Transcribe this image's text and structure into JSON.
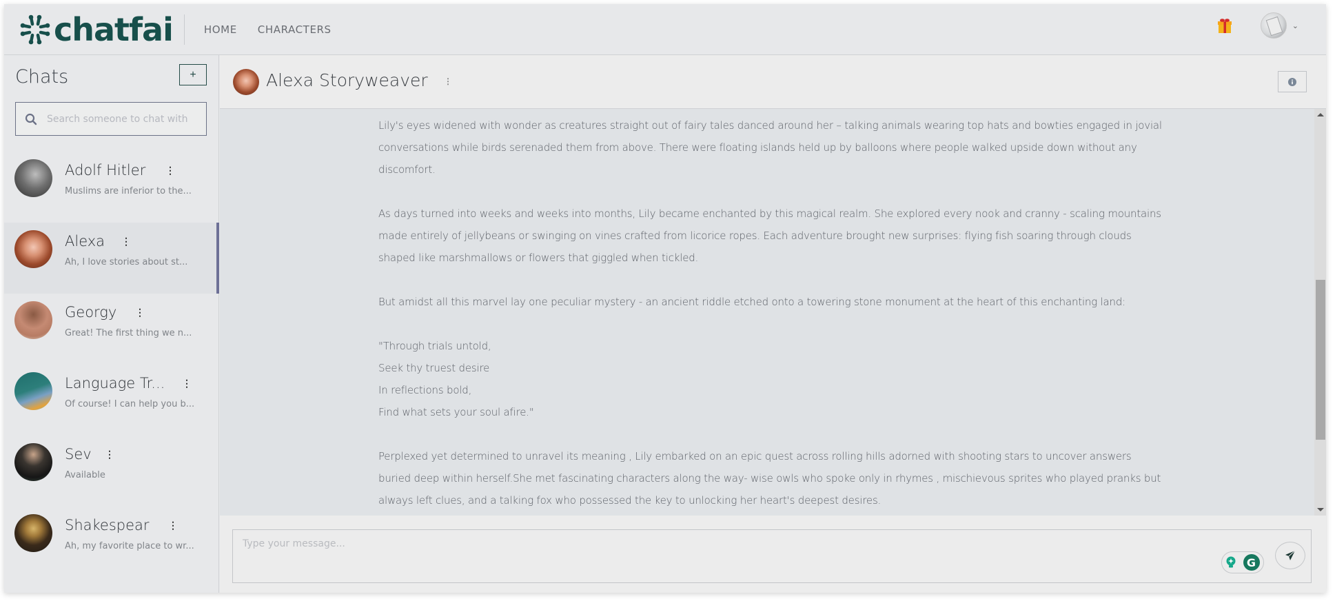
{
  "app": {
    "brand": "chatfai",
    "brand_color": "#174f4b",
    "accent_color": "#6d7096"
  },
  "nav": {
    "links": [
      {
        "label": "HOME"
      },
      {
        "label": "CHARACTERS"
      }
    ],
    "gift_icon": "gift-icon",
    "user_menu_icon": "chevron-down-icon",
    "chevron_glyph": "⌄"
  },
  "sidebar": {
    "title": "Chats",
    "new_chat_label": "+",
    "search_placeholder": "Search someone to chat with",
    "chats": [
      {
        "name": "Adolf Hitler",
        "preview": "Muslims are inferior to the...",
        "active": false
      },
      {
        "name": "Alexa",
        "preview": "Ah, I love stories about st...",
        "active": true
      },
      {
        "name": "Georgy",
        "preview": "Great! The first thing we n...",
        "active": false
      },
      {
        "name": "Language Tr...",
        "preview": "Of course! I can help you b...",
        "active": false
      },
      {
        "name": "Sev",
        "preview": "Available",
        "active": false
      },
      {
        "name": "Shakespear",
        "preview": "Ah, my favorite place to wr...",
        "active": false
      }
    ],
    "menu_glyph": "⋮"
  },
  "chat": {
    "title": "Alexa Storyweaver",
    "menu_glyph": "⋮",
    "info_icon": "info-icon",
    "message_paragraphs": [
      "Lily's eyes widened with wonder as creatures straight out of fairy tales danced around her – talking animals wearing top hats and bowties engaged in jovial conversations while birds serenaded them from above. There were floating islands held up by balloons where people walked upside down without any discomfort.",
      "As days turned into weeks and weeks into months, Lily became enchanted by this magical realm. She explored every nook and cranny - scaling mountains made entirely of jellybeans or swinging on vines crafted from licorice ropes. Each adventure brought new surprises: flying fish soaring through clouds shaped like marshmallows or flowers that giggled when tickled.",
      "But amidst all this marvel lay one peculiar mystery - an ancient riddle etched onto a towering stone monument at the heart of this enchanting land:"
    ],
    "verse_lines": [
      "\"Through trials untold,",
      "Seek thy truest desire",
      "In reflections bold,",
      "Find what sets your soul afire.\""
    ],
    "closing_paragraph": "Perplexed yet determined to unravel its meaning , Lily embarked on an epic quest across rolling hills adorned with shooting stars to uncover answers buried deep within herself.She met fascinating characters along the way- wise owls who spoke only in rhymes , mischievous sprites who played pranks but always left clues, and a talking fox who possessed the key to unlocking her heart's deepest desires.",
    "scroll_position": 0.55
  },
  "composer": {
    "placeholder": "Type your message...",
    "value": "",
    "grammarly_glyph": "G",
    "send_icon": "send-icon"
  }
}
